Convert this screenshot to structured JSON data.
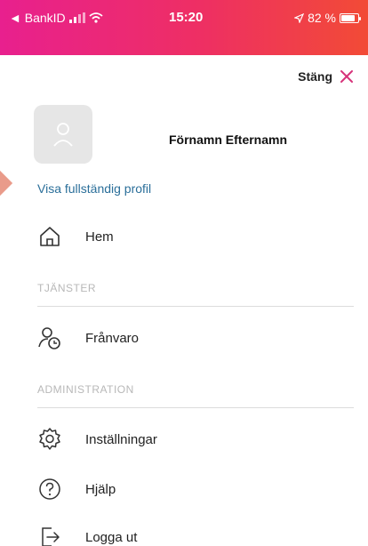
{
  "status_bar": {
    "back_app": "◄ BankID",
    "time": "15:20",
    "battery": "82 %",
    "battery_level": 0.82
  },
  "header": {
    "close_label": "Stäng"
  },
  "profile": {
    "name": "Förnamn Efternamn",
    "link": "Visa fullständig profil"
  },
  "menu": {
    "home": {
      "label": "Hem",
      "icon": "home-icon"
    },
    "services_title": "TJÄNSTER",
    "absence": {
      "label": "Frånvaro",
      "icon": "absence-icon"
    },
    "admin_title": "ADMINISTRATION",
    "settings": {
      "label": "Inställningar",
      "icon": "gear-icon"
    },
    "help": {
      "label": "Hjälp",
      "icon": "help-icon"
    },
    "logout": {
      "label": "Logga ut",
      "icon": "logout-icon"
    }
  },
  "colors": {
    "accent": "#e8208e",
    "link": "#2b6f9a",
    "close": "#d6337a"
  }
}
